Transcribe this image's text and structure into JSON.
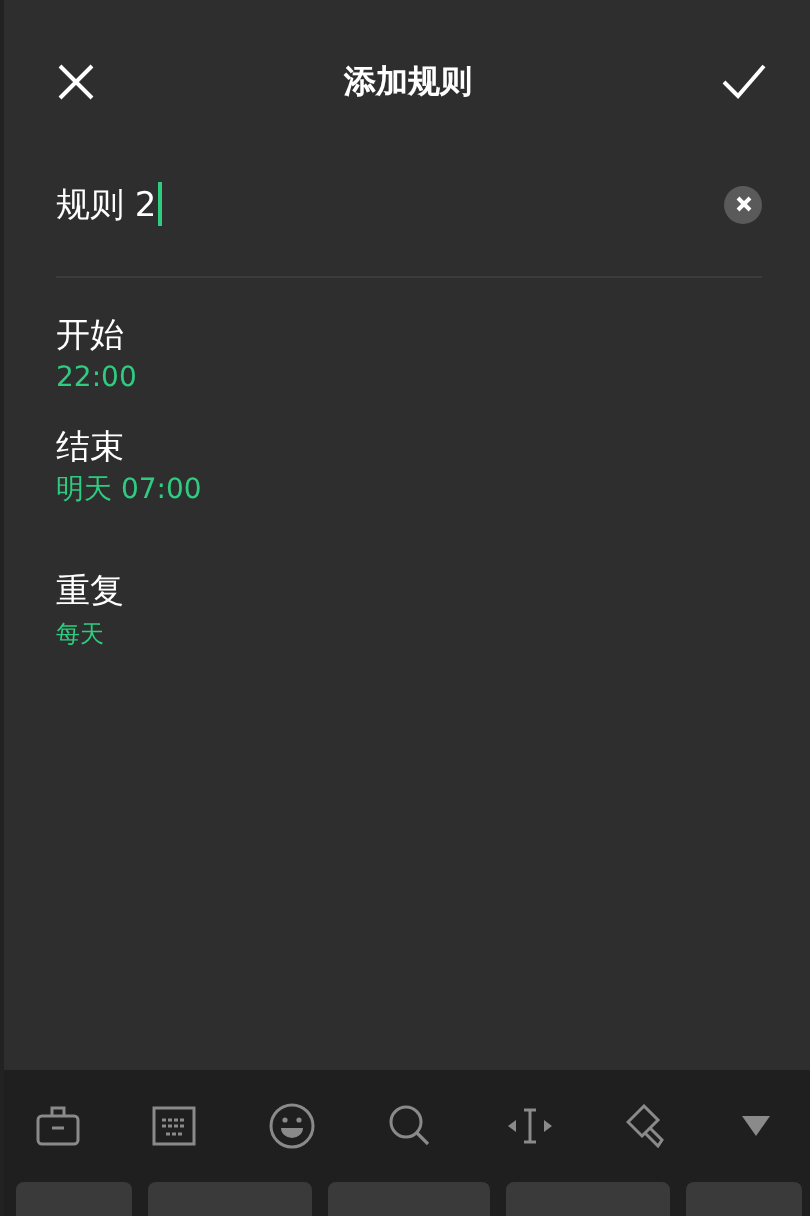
{
  "header": {
    "title": "添加规则"
  },
  "name_field": {
    "value": "规则 2"
  },
  "settings": [
    {
      "label": "开始",
      "value": "22:00",
      "kind": "large"
    },
    {
      "label": "结束",
      "value": "明天 07:00",
      "kind": "large"
    },
    {
      "label": "重复",
      "value": "每天",
      "kind": "small"
    }
  ],
  "keyboard": {
    "tools": [
      {
        "kind": "toolbox"
      },
      {
        "kind": "keyboard"
      },
      {
        "kind": "emoji"
      },
      {
        "kind": "search"
      },
      {
        "kind": "cursor"
      },
      {
        "kind": "brush"
      },
      {
        "kind": "collapse"
      }
    ],
    "keys": [
      {
        "kind": "side"
      },
      {
        "kind": "wide"
      },
      {
        "kind": "wide"
      },
      {
        "kind": "wide"
      },
      {
        "kind": "side"
      }
    ]
  }
}
